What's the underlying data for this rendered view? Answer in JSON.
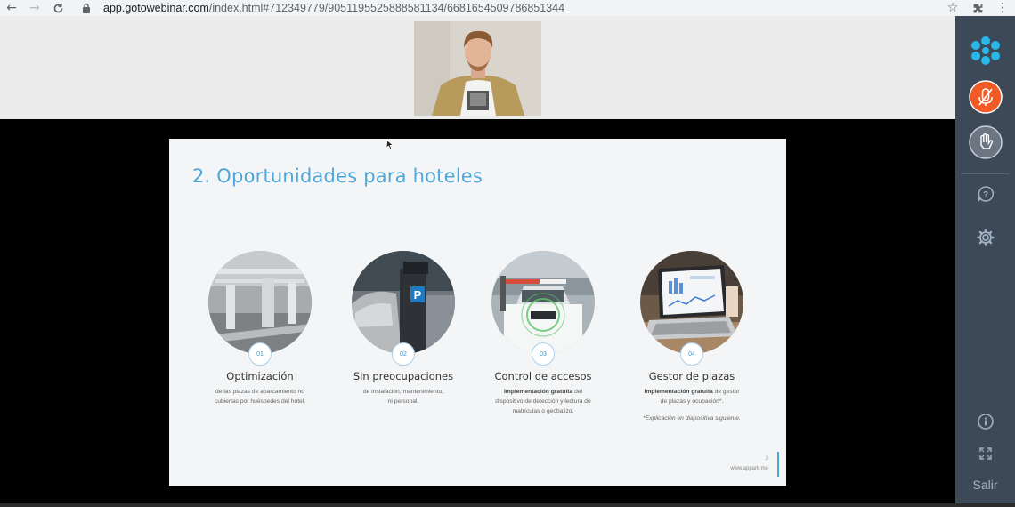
{
  "browser": {
    "url_host": "app.gotowebinar.com",
    "url_path": "/index.html#712349779/9051195525888581134/6681654509786851344",
    "icons": [
      "back-arrow-icon",
      "forward-arrow-icon",
      "reload-icon",
      "lock-icon",
      "star-icon",
      "extensions-icon",
      "menu-dots-icon"
    ]
  },
  "slide": {
    "title": "2. Oportunidades para hoteles",
    "features": [
      {
        "number": "01",
        "title": "Optimización",
        "desc_line1": "de las plazas de aparcamiento no",
        "desc_line2": "cubiertas por huéspedes del hotel."
      },
      {
        "number": "02",
        "title": "Sin preocupaciones",
        "desc_line1": "de instalación, mantenimiento,",
        "desc_line2": "ni personal."
      },
      {
        "number": "03",
        "title": "Control de accesos",
        "desc_bold": "Implementación gratuita",
        "desc_rest1": " del",
        "desc_line2": "dispositivo de detección y lectura de",
        "desc_line3": "matrículas o geobalizo."
      },
      {
        "number": "04",
        "title": "Gestor de plazas",
        "desc_bold": "Implementación gratuita",
        "desc_rest1": " de gestor",
        "desc_line2": "de plazas y ocupación*.",
        "note": "*Explicación en diapositiva siguiente."
      }
    ],
    "page_number": "3",
    "footer_url": "www.appark.me"
  },
  "panel": {
    "logo_icon": "gotowebinar-logo-icon",
    "mic_icon": "microphone-muted-icon",
    "hand_icon": "raise-hand-icon",
    "question_icon": "question-icon",
    "settings_icon": "gear-icon",
    "info_icon": "info-icon",
    "fullscreen_icon": "fullscreen-icon",
    "exit_label": "Salir",
    "colors": {
      "panel_bg": "#3e4957",
      "mic_active": "#f15a24",
      "logo": "#29b6e8"
    }
  }
}
